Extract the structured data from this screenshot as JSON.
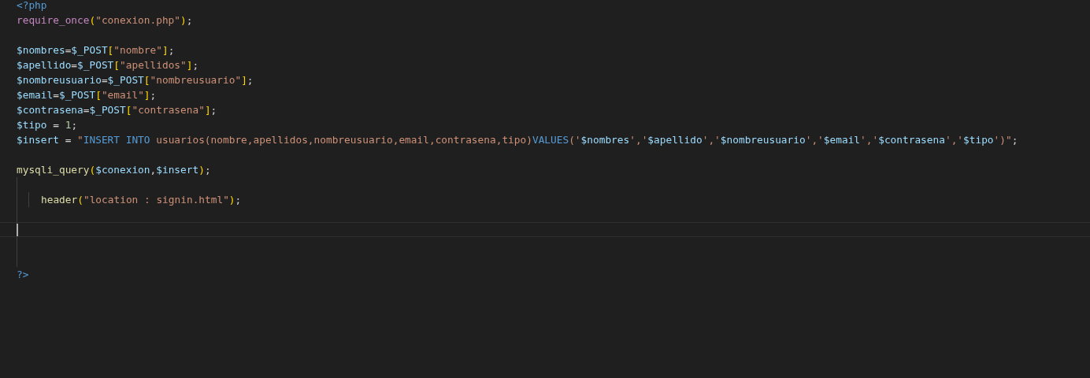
{
  "editor": {
    "lines": [
      {
        "guide": false,
        "cursor": false,
        "tokens": [
          {
            "kind": "tag",
            "text": "<?php"
          }
        ]
      },
      {
        "guide": false,
        "cursor": false,
        "tokens": [
          {
            "kind": "control",
            "text": "require_once"
          },
          {
            "kind": "bracket",
            "text": "("
          },
          {
            "kind": "string",
            "text": "\"conexion.php\""
          },
          {
            "kind": "bracket",
            "text": ")"
          },
          {
            "kind": "plain",
            "text": ";"
          }
        ]
      },
      {
        "guide": false,
        "cursor": false
      },
      {
        "guide": false,
        "cursor": false,
        "tokens": [
          {
            "kind": "variable",
            "text": "$nombres"
          },
          {
            "kind": "plain",
            "text": "="
          },
          {
            "kind": "variable",
            "text": "$_POST"
          },
          {
            "kind": "bracket",
            "text": "["
          },
          {
            "kind": "string",
            "text": "\"nombre\""
          },
          {
            "kind": "bracket",
            "text": "]"
          },
          {
            "kind": "plain",
            "text": ";"
          }
        ]
      },
      {
        "guide": false,
        "cursor": false,
        "tokens": [
          {
            "kind": "variable",
            "text": "$apellido"
          },
          {
            "kind": "plain",
            "text": "="
          },
          {
            "kind": "variable",
            "text": "$_POST"
          },
          {
            "kind": "bracket",
            "text": "["
          },
          {
            "kind": "string",
            "text": "\"apellidos\""
          },
          {
            "kind": "bracket",
            "text": "]"
          },
          {
            "kind": "plain",
            "text": ";"
          }
        ]
      },
      {
        "guide": false,
        "cursor": false,
        "tokens": [
          {
            "kind": "variable",
            "text": "$nombreusuario"
          },
          {
            "kind": "plain",
            "text": "="
          },
          {
            "kind": "variable",
            "text": "$_POST"
          },
          {
            "kind": "bracket",
            "text": "["
          },
          {
            "kind": "string",
            "text": "\"nombreusuario\""
          },
          {
            "kind": "bracket",
            "text": "]"
          },
          {
            "kind": "plain",
            "text": ";"
          }
        ]
      },
      {
        "guide": false,
        "cursor": false,
        "tokens": [
          {
            "kind": "variable",
            "text": "$email"
          },
          {
            "kind": "plain",
            "text": "="
          },
          {
            "kind": "variable",
            "text": "$_POST"
          },
          {
            "kind": "bracket",
            "text": "["
          },
          {
            "kind": "string",
            "text": "\"email\""
          },
          {
            "kind": "bracket",
            "text": "]"
          },
          {
            "kind": "plain",
            "text": ";"
          }
        ]
      },
      {
        "guide": false,
        "cursor": false,
        "tokens": [
          {
            "kind": "variable",
            "text": "$contrasena"
          },
          {
            "kind": "plain",
            "text": "="
          },
          {
            "kind": "variable",
            "text": "$_POST"
          },
          {
            "kind": "bracket",
            "text": "["
          },
          {
            "kind": "string",
            "text": "\"contrasena\""
          },
          {
            "kind": "bracket",
            "text": "]"
          },
          {
            "kind": "plain",
            "text": ";"
          }
        ]
      },
      {
        "guide": false,
        "cursor": false,
        "tokens": [
          {
            "kind": "variable",
            "text": "$tipo"
          },
          {
            "kind": "plain",
            "text": " = "
          },
          {
            "kind": "number",
            "text": "1"
          },
          {
            "kind": "plain",
            "text": ";"
          }
        ]
      },
      {
        "guide": false,
        "cursor": false,
        "tokens": [
          {
            "kind": "variable",
            "text": "$insert"
          },
          {
            "kind": "plain",
            "text": " = "
          },
          {
            "kind": "string",
            "text": "\""
          },
          {
            "kind": "keyword",
            "text": "INSERT INTO"
          },
          {
            "kind": "string",
            "text": " usuarios(nombre,apellidos,nombreusuario,email,contrasena,tipo)"
          },
          {
            "kind": "keyword",
            "text": "VALUES"
          },
          {
            "kind": "string",
            "text": "('"
          },
          {
            "kind": "variable",
            "text": "$nombres"
          },
          {
            "kind": "string",
            "text": "','"
          },
          {
            "kind": "variable",
            "text": "$apellido"
          },
          {
            "kind": "string",
            "text": "','"
          },
          {
            "kind": "variable",
            "text": "$nombreusuario"
          },
          {
            "kind": "string",
            "text": "','"
          },
          {
            "kind": "variable",
            "text": "$email"
          },
          {
            "kind": "string",
            "text": "','"
          },
          {
            "kind": "variable",
            "text": "$contrasena"
          },
          {
            "kind": "string",
            "text": "','"
          },
          {
            "kind": "variable",
            "text": "$tipo"
          },
          {
            "kind": "string",
            "text": "')\""
          },
          {
            "kind": "plain",
            "text": ";"
          }
        ]
      },
      {
        "guide": false,
        "cursor": false
      },
      {
        "guide": false,
        "cursor": false,
        "tokens": [
          {
            "kind": "function",
            "text": "mysqli_query"
          },
          {
            "kind": "bracket",
            "text": "("
          },
          {
            "kind": "variable",
            "text": "$conexion"
          },
          {
            "kind": "plain",
            "text": ","
          },
          {
            "kind": "variable",
            "text": "$insert"
          },
          {
            "kind": "bracket",
            "text": ")"
          },
          {
            "kind": "plain",
            "text": ";"
          }
        ]
      },
      {
        "guide": true,
        "cursor": false
      },
      {
        "guide": true,
        "cursor": false,
        "indented": true,
        "tokens": [
          {
            "kind": "function",
            "text": "header"
          },
          {
            "kind": "bracket",
            "text": "("
          },
          {
            "kind": "string",
            "text": "\"location : signin.html\""
          },
          {
            "kind": "bracket",
            "text": ")"
          },
          {
            "kind": "plain",
            "text": ";"
          }
        ]
      },
      {
        "guide": true,
        "cursor": false
      },
      {
        "guide": true,
        "cursor": true
      },
      {
        "guide": true,
        "cursor": false
      },
      {
        "guide": true,
        "cursor": false
      },
      {
        "guide": false,
        "cursor": false,
        "tokens": [
          {
            "kind": "tag",
            "text": "?>"
          }
        ]
      }
    ]
  }
}
